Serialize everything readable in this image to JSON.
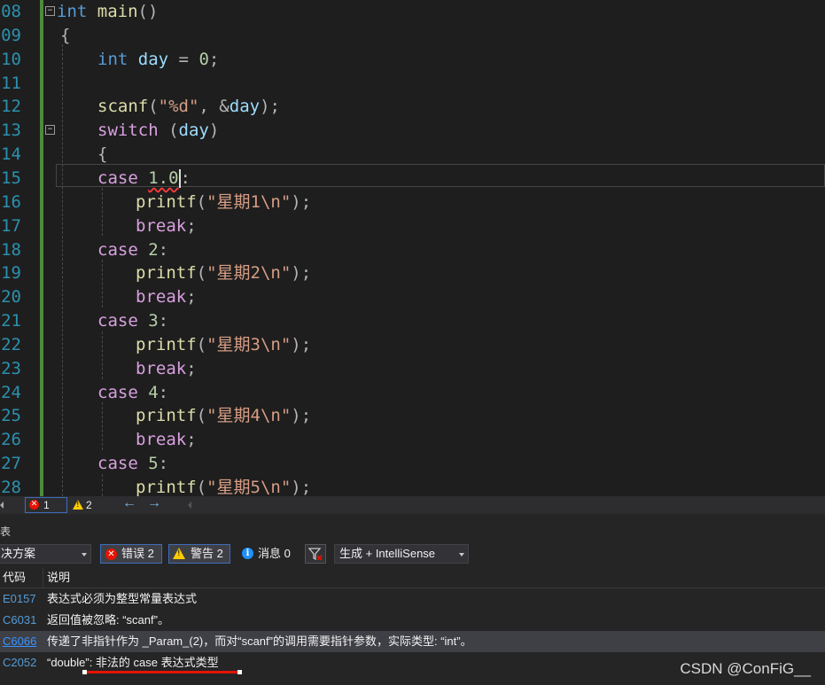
{
  "editor": {
    "lines": [
      {
        "num": "08",
        "tokens": [
          {
            "t": "int",
            "c": "kw"
          },
          {
            "t": " ",
            "c": ""
          },
          {
            "t": "main",
            "c": "fn"
          },
          {
            "t": "()",
            "c": "pun"
          }
        ]
      },
      {
        "num": "09",
        "tokens": [
          {
            "t": "{",
            "c": "pun"
          }
        ]
      },
      {
        "num": "10",
        "tokens": [
          {
            "t": "int",
            "c": "kw"
          },
          {
            "t": " ",
            "c": ""
          },
          {
            "t": "day",
            "c": "var"
          },
          {
            "t": " = ",
            "c": "pun"
          },
          {
            "t": "0",
            "c": "num"
          },
          {
            "t": ";",
            "c": "pun"
          }
        ]
      },
      {
        "num": "11",
        "tokens": []
      },
      {
        "num": "12",
        "tokens": [
          {
            "t": "scanf",
            "c": "fn"
          },
          {
            "t": "(",
            "c": "pun"
          },
          {
            "t": "\"%d\"",
            "c": "str"
          },
          {
            "t": ", &",
            "c": "pun"
          },
          {
            "t": "day",
            "c": "var"
          },
          {
            "t": ");",
            "c": "pun"
          }
        ]
      },
      {
        "num": "13",
        "tokens": [
          {
            "t": "switch",
            "c": "ctl"
          },
          {
            "t": " (",
            "c": "pun"
          },
          {
            "t": "day",
            "c": "var"
          },
          {
            "t": ")",
            "c": "pun"
          }
        ]
      },
      {
        "num": "14",
        "tokens": [
          {
            "t": "{",
            "c": "pun"
          }
        ]
      },
      {
        "num": "15",
        "tokens": [
          {
            "t": "case",
            "c": "ctl"
          },
          {
            "t": " ",
            "c": ""
          },
          {
            "t": "1.0",
            "c": "num squig"
          },
          {
            "t": ":",
            "c": "pun"
          }
        ]
      },
      {
        "num": "16",
        "tokens": [
          {
            "t": "printf",
            "c": "fn"
          },
          {
            "t": "(",
            "c": "pun"
          },
          {
            "t": "\"星期1\\n\"",
            "c": "str"
          },
          {
            "t": ");",
            "c": "pun"
          }
        ]
      },
      {
        "num": "17",
        "tokens": [
          {
            "t": "break",
            "c": "ctl"
          },
          {
            "t": ";",
            "c": "pun"
          }
        ]
      },
      {
        "num": "18",
        "tokens": [
          {
            "t": "case",
            "c": "ctl"
          },
          {
            "t": " ",
            "c": ""
          },
          {
            "t": "2",
            "c": "num"
          },
          {
            "t": ":",
            "c": "pun"
          }
        ]
      },
      {
        "num": "19",
        "tokens": [
          {
            "t": "printf",
            "c": "fn"
          },
          {
            "t": "(",
            "c": "pun"
          },
          {
            "t": "\"星期2\\n\"",
            "c": "str"
          },
          {
            "t": ");",
            "c": "pun"
          }
        ]
      },
      {
        "num": "20",
        "tokens": [
          {
            "t": "break",
            "c": "ctl"
          },
          {
            "t": ";",
            "c": "pun"
          }
        ]
      },
      {
        "num": "21",
        "tokens": [
          {
            "t": "case",
            "c": "ctl"
          },
          {
            "t": " ",
            "c": ""
          },
          {
            "t": "3",
            "c": "num"
          },
          {
            "t": ":",
            "c": "pun"
          }
        ]
      },
      {
        "num": "22",
        "tokens": [
          {
            "t": "printf",
            "c": "fn"
          },
          {
            "t": "(",
            "c": "pun"
          },
          {
            "t": "\"星期3\\n\"",
            "c": "str"
          },
          {
            "t": ");",
            "c": "pun"
          }
        ]
      },
      {
        "num": "23",
        "tokens": [
          {
            "t": "break",
            "c": "ctl"
          },
          {
            "t": ";",
            "c": "pun"
          }
        ]
      },
      {
        "num": "24",
        "tokens": [
          {
            "t": "case",
            "c": "ctl"
          },
          {
            "t": " ",
            "c": ""
          },
          {
            "t": "4",
            "c": "num"
          },
          {
            "t": ":",
            "c": "pun"
          }
        ]
      },
      {
        "num": "25",
        "tokens": [
          {
            "t": "printf",
            "c": "fn"
          },
          {
            "t": "(",
            "c": "pun"
          },
          {
            "t": "\"星期4\\n\"",
            "c": "str"
          },
          {
            "t": ");",
            "c": "pun"
          }
        ]
      },
      {
        "num": "26",
        "tokens": [
          {
            "t": "break",
            "c": "ctl"
          },
          {
            "t": ";",
            "c": "pun"
          }
        ]
      },
      {
        "num": "27",
        "tokens": [
          {
            "t": "case",
            "c": "ctl"
          },
          {
            "t": " ",
            "c": ""
          },
          {
            "t": "5",
            "c": "num"
          },
          {
            "t": ":",
            "c": "pun"
          }
        ]
      },
      {
        "num": "28",
        "tokens": [
          {
            "t": "printf",
            "c": "fn"
          },
          {
            "t": "(",
            "c": "pun"
          },
          {
            "t": "\"星期5\\n\"",
            "c": "str"
          },
          {
            "t": ");",
            "c": "pun"
          }
        ]
      }
    ]
  },
  "status_strip": {
    "error_count": "1",
    "warning_count": "2"
  },
  "error_list": {
    "panel_title": "表",
    "scope_dropdown": "决方案",
    "errors_button": "错误 2",
    "warnings_button": "警告 2",
    "messages_button": "消息 0",
    "build_dropdown": "生成 + IntelliSense",
    "headers": {
      "code": "代码",
      "description": "说明"
    },
    "rows": [
      {
        "code": "E0157",
        "desc": "表达式必须为整型常量表达式"
      },
      {
        "code": "C6031",
        "desc": "返回值被忽略: “scanf”。"
      },
      {
        "code": "C6066",
        "desc": "传递了非指针作为 _Param_(2)，而对“scanf”的调用需要指针参数，实际类型: “int”。"
      },
      {
        "code": "C2052",
        "desc": "“double”: 非法的 case 表达式类型"
      }
    ]
  },
  "watermark": "CSDN @ConFiG__",
  "colors": {
    "accent": "#007acc",
    "error": "#e51400",
    "warning": "#ffcc00",
    "annotation": "#e51400"
  }
}
